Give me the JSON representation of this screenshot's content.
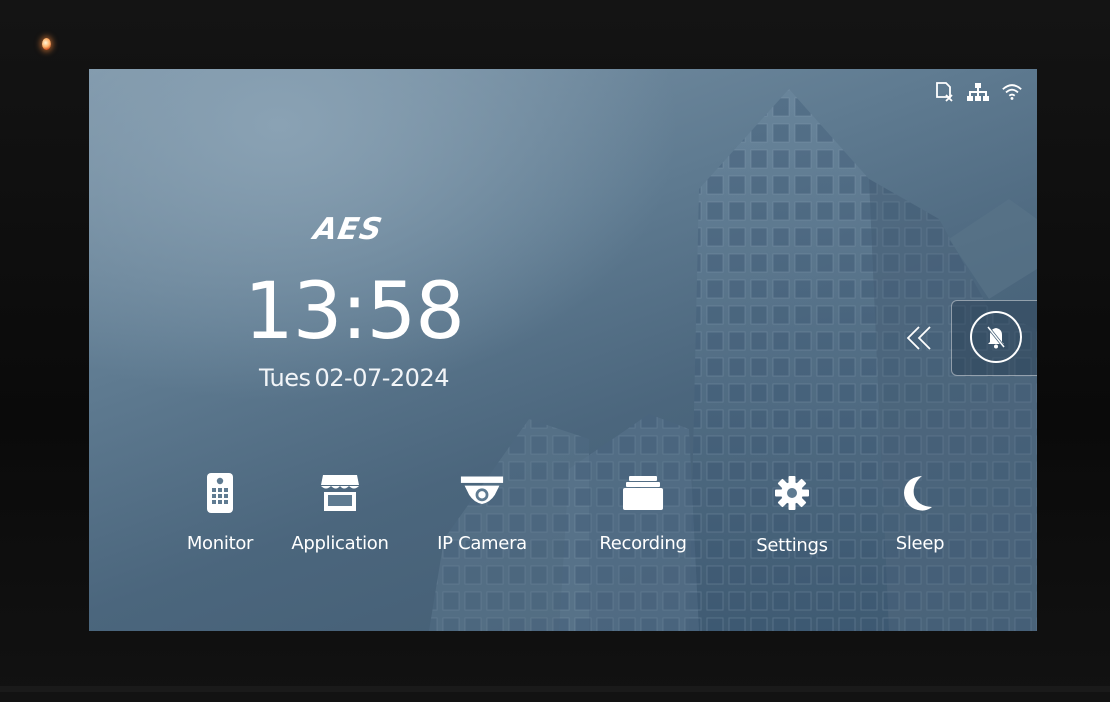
{
  "brand": {
    "logo_text": "AES"
  },
  "clock": {
    "time": "13:58",
    "weekday": "Tues",
    "date": "02-07-2024"
  },
  "status_icons": [
    "sd-card-missing-icon",
    "ethernet-network-icon",
    "wifi-icon"
  ],
  "side_panel": {
    "collapse_icon": "double-chevron-left-icon",
    "mute_icon": "bell-muted-icon"
  },
  "apps": [
    {
      "label": "Monitor",
      "icon": "door-station-icon"
    },
    {
      "label": "Application",
      "icon": "storefront-icon"
    },
    {
      "label": "IP Camera",
      "icon": "dome-camera-icon"
    },
    {
      "label": "Recording",
      "icon": "folder-stack-icon"
    },
    {
      "label": "Settings",
      "icon": "gear-icon"
    },
    {
      "label": "Sleep",
      "icon": "moon-icon"
    }
  ],
  "colors": {
    "screen_bg": "#5f7b91",
    "icon_white": "#ffffff",
    "led": "#ff8c3c"
  }
}
